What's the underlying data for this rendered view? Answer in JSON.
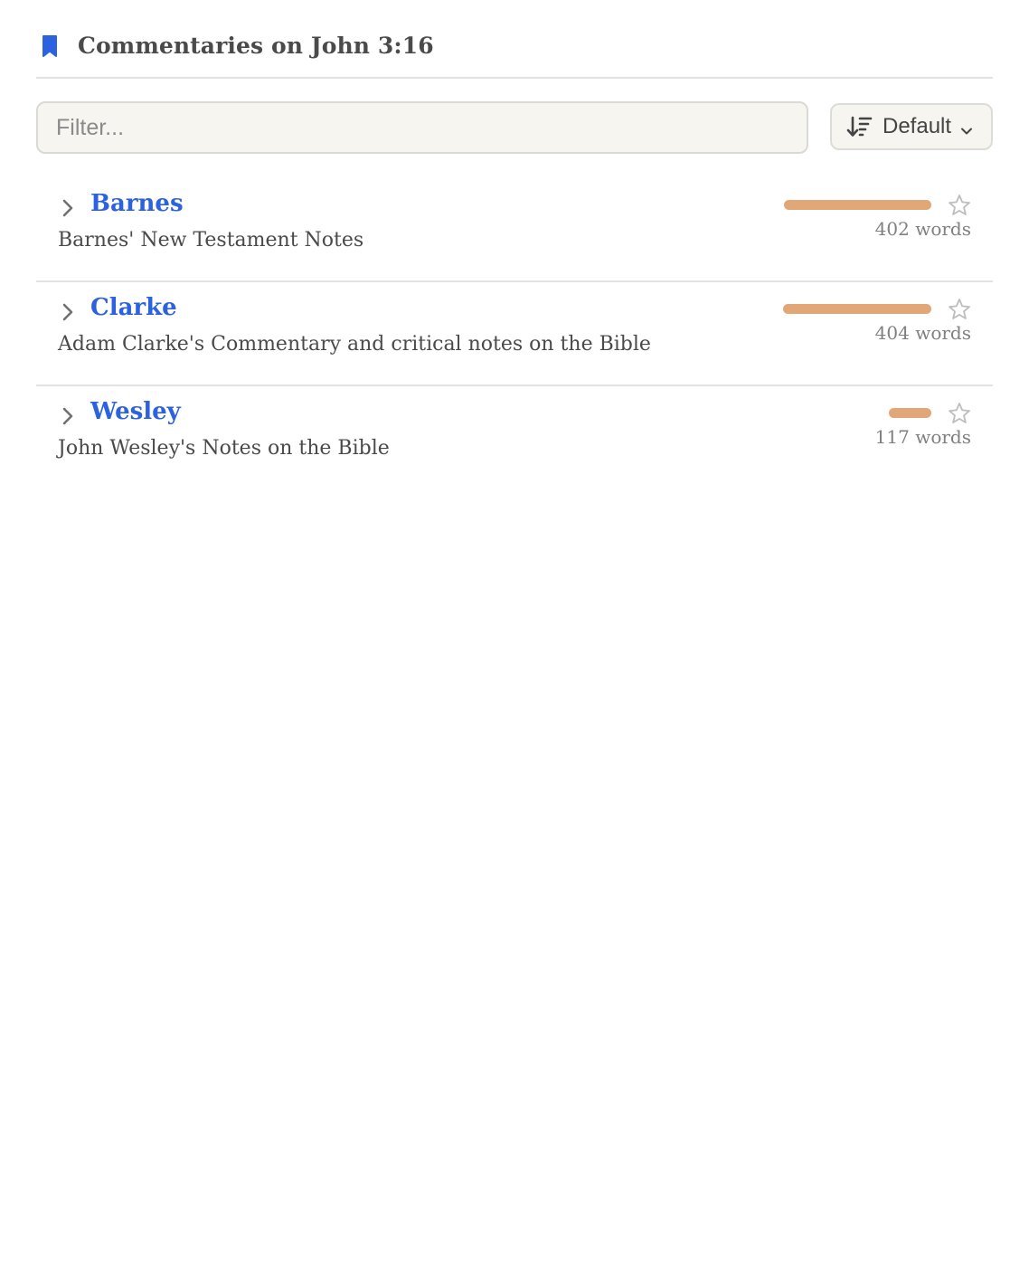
{
  "header": {
    "title": "Commentaries on John 3:16",
    "icon": "bookmark-icon",
    "icon_color": "#2c62e0"
  },
  "toolbar": {
    "filter_placeholder": "Filter...",
    "filter_value": "",
    "sort_label": "Default",
    "sort_icon": "sort-descending-icon"
  },
  "colors": {
    "link": "#2c62e0",
    "bar": "#e2a776",
    "text": "#4a4a4a"
  },
  "commentaries": [
    {
      "name": "Barnes",
      "description": "Barnes' New Testament Notes",
      "words": "402 words",
      "word_count": 402,
      "starred": false
    },
    {
      "name": "Clarke",
      "description": "Adam Clarke's Commentary and critical notes on the Bible",
      "words": "404 words",
      "word_count": 404,
      "starred": false
    },
    {
      "name": "Wesley",
      "description": "John Wesley's Notes on the Bible",
      "words": "117 words",
      "word_count": 117,
      "starred": false
    }
  ]
}
